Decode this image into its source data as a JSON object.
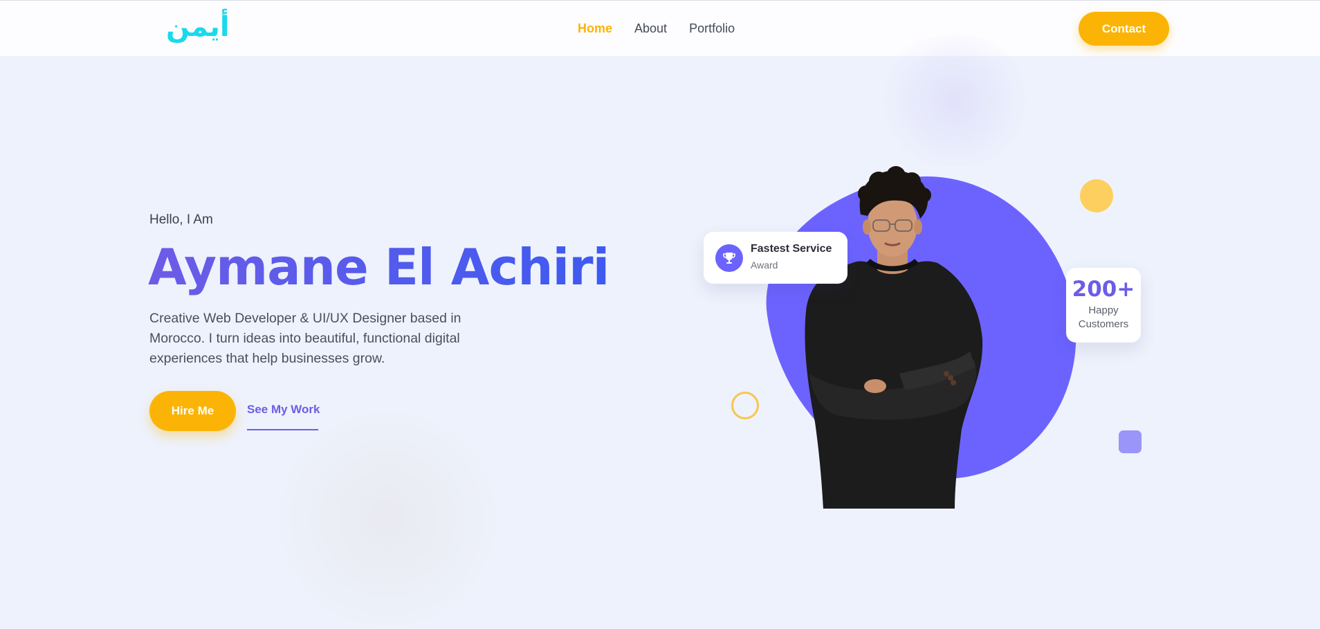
{
  "header": {
    "logo_text": "أيمن",
    "nav": [
      {
        "label": "Home",
        "active": true
      },
      {
        "label": "About",
        "active": false
      },
      {
        "label": "Portfolio",
        "active": false
      }
    ],
    "contact_label": "Contact"
  },
  "hero": {
    "greeting": "Hello, I Am",
    "name": "Aymane El Achiri",
    "description": "Creative Web Developer & UI/UX Designer based in Morocco. I turn ideas into beautiful, functional digital experiences that help businesses grow.",
    "hire_label": "Hire Me",
    "work_label": "See My Work"
  },
  "award": {
    "icon": "trophy-icon",
    "title": "Fastest Service",
    "subtitle": "Award"
  },
  "customers": {
    "count": "200+",
    "label_line1": "Happy",
    "label_line2": "Customers"
  },
  "colors": {
    "accent_yellow": "#fbb405",
    "accent_purple": "#6c63ff",
    "logo_cyan": "#19d9ec",
    "background": "#eef2fc"
  }
}
